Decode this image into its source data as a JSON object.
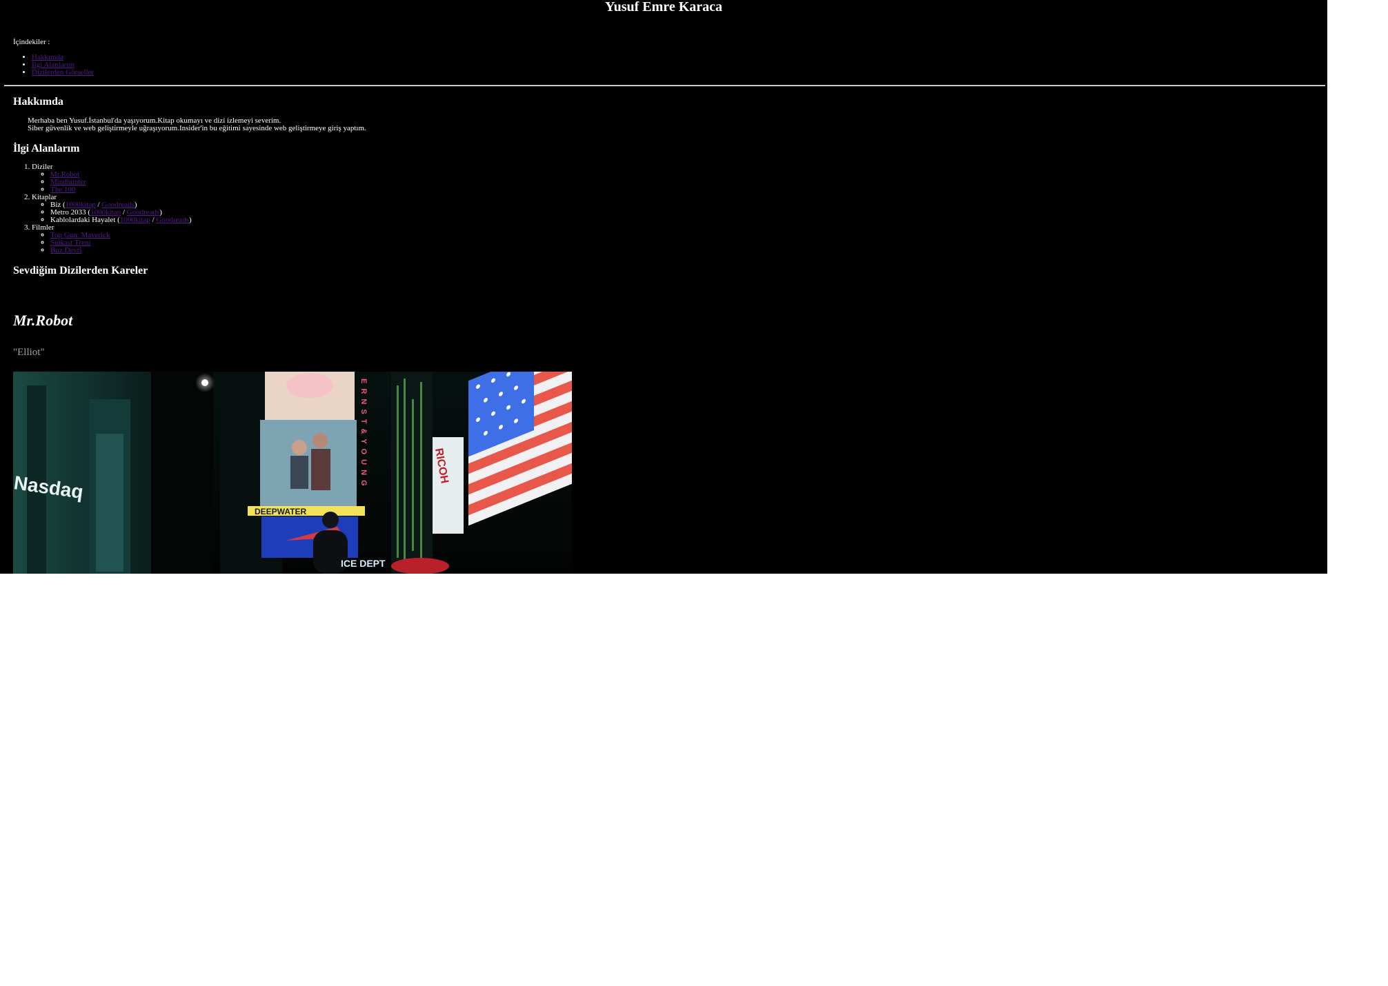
{
  "header": {
    "title": "Yusuf Emre Karaca"
  },
  "toc": {
    "label": "İçindekiler :",
    "items": [
      "Hakkımda",
      "İlgi Alanlarım",
      "Dizilerden Görseller"
    ]
  },
  "about": {
    "heading": "Hakkımda",
    "line1": "Merhaba ben Yusuf.İstanbul'da yaşıyorum.Kitap okumayı ve dizi izlemeyi severim.",
    "line2": "Siber güvenlik ve web geliştirmeyle uğraşıyorum.Insider'in bu eğitimi sayesinde web geliştirmeye giriş yaptım."
  },
  "interests": {
    "heading": "İlgi Alanlarım",
    "series": {
      "label": "Diziler",
      "items": [
        "Mr.Robot",
        "Mindhunter",
        "The 100"
      ]
    },
    "books": {
      "label": "Kitaplar",
      "items": [
        {
          "title": "Biz",
          "link1": "1000kitap",
          "sep": "/",
          "link2": "Goodreads"
        },
        {
          "title": "Metro 2033",
          "link1": "1000kitap",
          "sep": "/",
          "link2": "Goodreads"
        },
        {
          "title": "Kablolardaki Hayalet",
          "link1": "1000kitap",
          "sep": "/",
          "link2": "Goodreads"
        }
      ]
    },
    "films": {
      "label": "Filmler",
      "items": [
        "Top Gun: Maverick",
        "Suikast Treni",
        "Buz Devri"
      ]
    }
  },
  "gallery": {
    "heading": "Sevdiğim Dizilerden Kareler",
    "title": "Mr.Robot",
    "caption": "\"Elliot\"",
    "image_texts": {
      "nasdaq": "Nasdaq",
      "billboard": "E R N S T & Y O U N G",
      "ricoh": "RICOH",
      "marquee": "DEEPWATER",
      "police": "ICE DEPT"
    }
  },
  "colors": {
    "page_background": "#000000",
    "text": "#ffffff",
    "link_visited": "#551a8b",
    "caption": "#a0a0a0",
    "below_page": "#ffffff"
  }
}
